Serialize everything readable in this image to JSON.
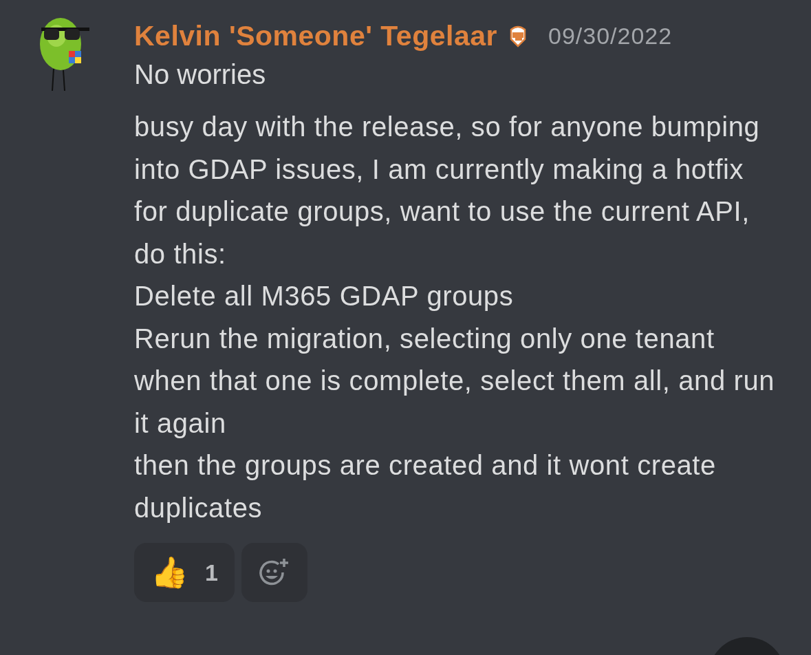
{
  "message": {
    "author": "Kelvin 'Someone' Tegelaar",
    "timestamp": "09/30/2022",
    "first_line": "No worries",
    "lines": [
      "busy day with the release, so for anyone bumping into GDAP issues, I am currently making a hotfix for duplicate groups, want to use the current API, do this:",
      "Delete all M365 GDAP groups",
      "Rerun the migration, selecting only one tenant",
      "when that one is complete, select them all, and run it again",
      "then the groups are created and it wont create duplicates"
    ],
    "reactions": [
      {
        "emoji": "👍",
        "count": "1"
      }
    ]
  }
}
